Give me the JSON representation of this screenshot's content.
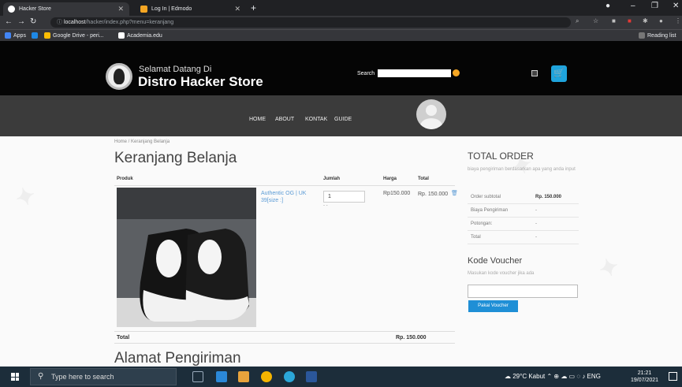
{
  "browser": {
    "tabs": [
      {
        "title": "Hacker Store",
        "active": true
      },
      {
        "title": "Log In | Edmodo",
        "active": false
      }
    ],
    "new_tab": "+",
    "url_host": "localhost",
    "url_path": "/hacker/index.php?menu=keranjang",
    "url_scheme_icon": "ⓘ",
    "bookmarks": [
      "Apps",
      "Google Drive - peri...",
      "Academia.edu"
    ],
    "reading_list": "Reading list"
  },
  "site": {
    "welcome": "Selamat Datang Di",
    "store_name": "Distro Hacker Store",
    "search_label": "Search",
    "nav": [
      "HOME",
      "ABOUT",
      "KONTAK",
      "GUIDE"
    ]
  },
  "cart": {
    "breadcrumb": "Home  /  Keranjang Belanja",
    "title": "Keranjang Belanja",
    "columns": [
      "Produk",
      "Jumlah",
      "Harga",
      "Total"
    ],
    "item": {
      "name": "Authentic OG | UK 39[size :]",
      "qty": "1",
      "qty_note": "- -",
      "price": "Rp150.000",
      "total": "Rp. 150.000",
      "delete_icon": "trash-icon"
    },
    "footer_label": "Total",
    "footer_total": "Rp. 150.000",
    "address_title": "Alamat Pengiriman"
  },
  "order": {
    "title": "TOTAL ORDER",
    "note": "biaya pengiriman berdasarkan apa yang anda input",
    "rows": [
      {
        "label": "Order subtotal",
        "value": "Rp. 150.000"
      },
      {
        "label": "Biaya Pengiriman",
        "value": "-"
      },
      {
        "label": "Potongan:",
        "value": "-"
      },
      {
        "label": "Total",
        "value": "-"
      }
    ],
    "voucher_title": "Kode Voucher",
    "voucher_note": "Masukan kode voucher jika ada",
    "voucher_button": "Pakai Voucher"
  },
  "taskbar": {
    "search_placeholder": "Type here to search",
    "weather": "29°C  Kabut",
    "lang": "ENG",
    "time": "21:21",
    "date": "19/07/2021"
  },
  "colors": {
    "header_bg": "#050505",
    "nav_bg": "#3b3b3b",
    "accent_blue": "#1f8fd6",
    "cart_blue": "#1fa4dd",
    "search_orange": "#f5a623"
  }
}
